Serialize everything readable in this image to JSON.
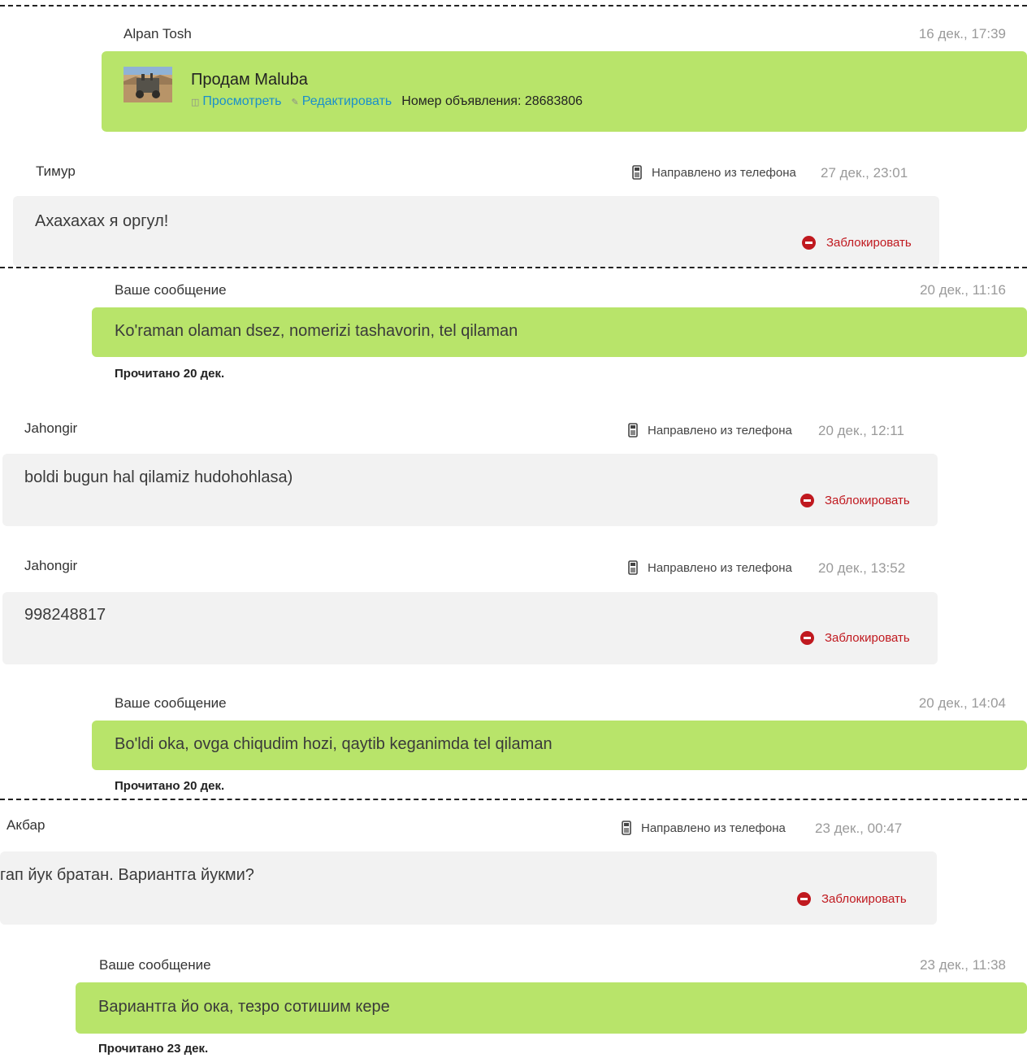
{
  "colors": {
    "my_bubble": "#b8e46a",
    "their_bubble": "#f2f2f2",
    "block_red": "#c0191f",
    "link_blue": "#1b8fcb"
  },
  "ad": {
    "author": "Alpan Tosh",
    "time": "16 дек., 17:39",
    "title": "Продам Maluba",
    "view_label": "Просмотреть",
    "edit_label": "Редактировать",
    "number_label": "Номер объявления: 28683806"
  },
  "messages": [
    {
      "author": "Тимур",
      "source": "Направлено из телефона",
      "time": "27 дек., 23:01",
      "text": "Ахахахах я оргул!",
      "block_label": "Заблокировать"
    },
    {
      "author": "Ваше сообщение",
      "time": "20 дек., 11:16",
      "text": "Ko'raman olaman dsez, nomerizi tashavorin, tel qilaman",
      "read": "Прочитано 20 дек."
    },
    {
      "author": "Jahongir",
      "source": "Направлено из телефона",
      "time": "20 дек., 12:11",
      "text": "boldi bugun hal qilamiz hudohohlasa)",
      "block_label": "Заблокировать"
    },
    {
      "author": "Jahongir",
      "source": "Направлено из телефона",
      "time": "20 дек., 13:52",
      "text": "998248817",
      "block_label": "Заблокировать"
    },
    {
      "author": "Ваше сообщение",
      "time": "20 дек., 14:04",
      "text": "Bo'ldi oka, ovga chiqudim hozi, qaytib keganimda tel qilaman",
      "read": "Прочитано 20 дек."
    },
    {
      "author": "Акбар",
      "source": "Направлено из телефона",
      "time": "23 дек., 00:47",
      "text": "гап йук братан. Вариантга йукми?",
      "block_label": "Заблокировать"
    },
    {
      "author": "Ваше сообщение",
      "time": "23 дек., 11:38",
      "text": "Вариантга йо ока, тезро сотишим кере",
      "read": "Прочитано 23 дек."
    }
  ]
}
